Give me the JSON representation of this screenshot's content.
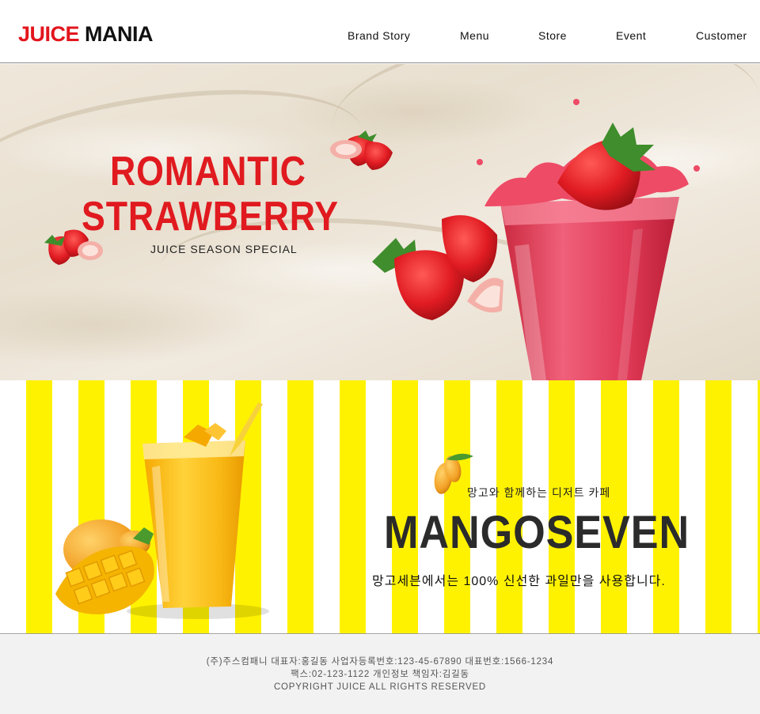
{
  "header": {
    "logo_part1": "JUICE",
    "logo_part2": "MANIA",
    "nav": [
      "Brand Story",
      "Menu",
      "Store",
      "Event",
      "Customer"
    ]
  },
  "hero_strawberry": {
    "title_line1": "ROMANTIC",
    "title_line2": "STRAWBERRY",
    "subtitle": "JUICE SEASON SPECIAL"
  },
  "hero_mango": {
    "tagline": "망고와 함께하는 디저트 카페",
    "title": "MANGOSEVEN",
    "description": "망고세븐에서는 100% 신선한 과일만을 사용합니다."
  },
  "footer": {
    "line1": "(주)주스컴패니 대표자:홍길동 사업자등록번호:123-45-67890 대표번호:1566-1234",
    "line2": "팩스:02-123-1122 개인정보 책임자:김길동",
    "line3": "COPYRIGHT JUICE ALL RIGHTS RESERVED"
  },
  "colors": {
    "brand_red": "#e3151d",
    "stripe_yellow": "#fff200",
    "title_dark": "#2b2b2b"
  }
}
